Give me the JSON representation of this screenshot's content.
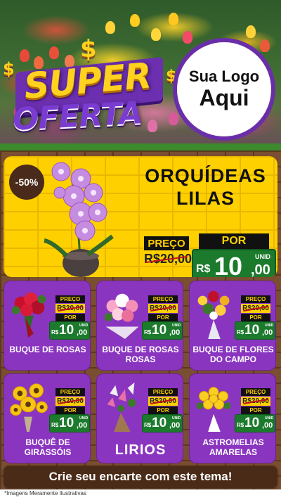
{
  "hero": {
    "badge_super": "SUPER",
    "badge_oferta": "OFERTA",
    "currency_symbol": "$",
    "logo_line1": "Sua Logo",
    "logo_line2": "Aqui"
  },
  "featured": {
    "discount": "-50%",
    "title_line1": "ORQUÍDEAS",
    "title_line2": "LILAS",
    "old_label": "PREÇO",
    "old_price": "R$20,00",
    "new_label": "POR",
    "currency": "R$",
    "price_int": "10",
    "price_cents": ",00",
    "unit": "UNID",
    "image_icon": "orchid-icon"
  },
  "products": [
    {
      "name_line1": "BUQUE DE ROSAS",
      "name_line2": "",
      "old_label": "PREÇO",
      "old_price": "R$20,00",
      "new_label": "POR",
      "currency": "R$",
      "price_int": "10",
      "price_cents": ",00",
      "unit": "UNID",
      "icon": "red-roses-bouquet-icon"
    },
    {
      "name_line1": "BUQUE DE ROSAS",
      "name_line2": "ROSAS",
      "old_label": "PREÇO",
      "old_price": "R$20,00",
      "new_label": "POR",
      "currency": "R$",
      "price_int": "10",
      "price_cents": ",00",
      "unit": "UNID",
      "icon": "pink-roses-bouquet-icon"
    },
    {
      "name_line1": "BUQUE DE FLORES",
      "name_line2": "DO CAMPO",
      "old_label": "PREÇO",
      "old_price": "R$20,00",
      "new_label": "POR",
      "currency": "R$",
      "price_int": "10",
      "price_cents": ",00",
      "unit": "UNID",
      "icon": "wildflowers-bouquet-icon"
    },
    {
      "name_line1": "BUQUÊ DE",
      "name_line2": "GIRASSÓIS",
      "old_label": "PREÇO",
      "old_price": "R$20,00",
      "new_label": "POR",
      "currency": "R$",
      "price_int": "10",
      "price_cents": ",00",
      "unit": "UNID",
      "icon": "sunflowers-bouquet-icon"
    },
    {
      "name_line1": "LIRIOS",
      "name_line2": "",
      "old_label": "PREÇO",
      "old_price": "R$20,00",
      "new_label": "POR",
      "currency": "R$",
      "price_int": "10",
      "price_cents": ",00",
      "unit": "UNID",
      "icon": "lilies-bouquet-icon"
    },
    {
      "name_line1": "ASTROMELIAS",
      "name_line2": "AMARELAS",
      "old_label": "PREÇO",
      "old_price": "R$20,00",
      "new_label": "POR",
      "currency": "R$",
      "price_int": "10",
      "price_cents": ",00",
      "unit": "UNID",
      "icon": "yellow-alstroemeria-bouquet-icon"
    }
  ],
  "cta": {
    "label": "Crie seu encarte com este tema!"
  },
  "footer": {
    "disclaimer": "*Imagens Meramente Ilustrativas"
  },
  "colors": {
    "purple": "#8a35c0",
    "yellow": "#ffd000",
    "green": "#1b7a2c",
    "brown": "#4a2b18"
  }
}
